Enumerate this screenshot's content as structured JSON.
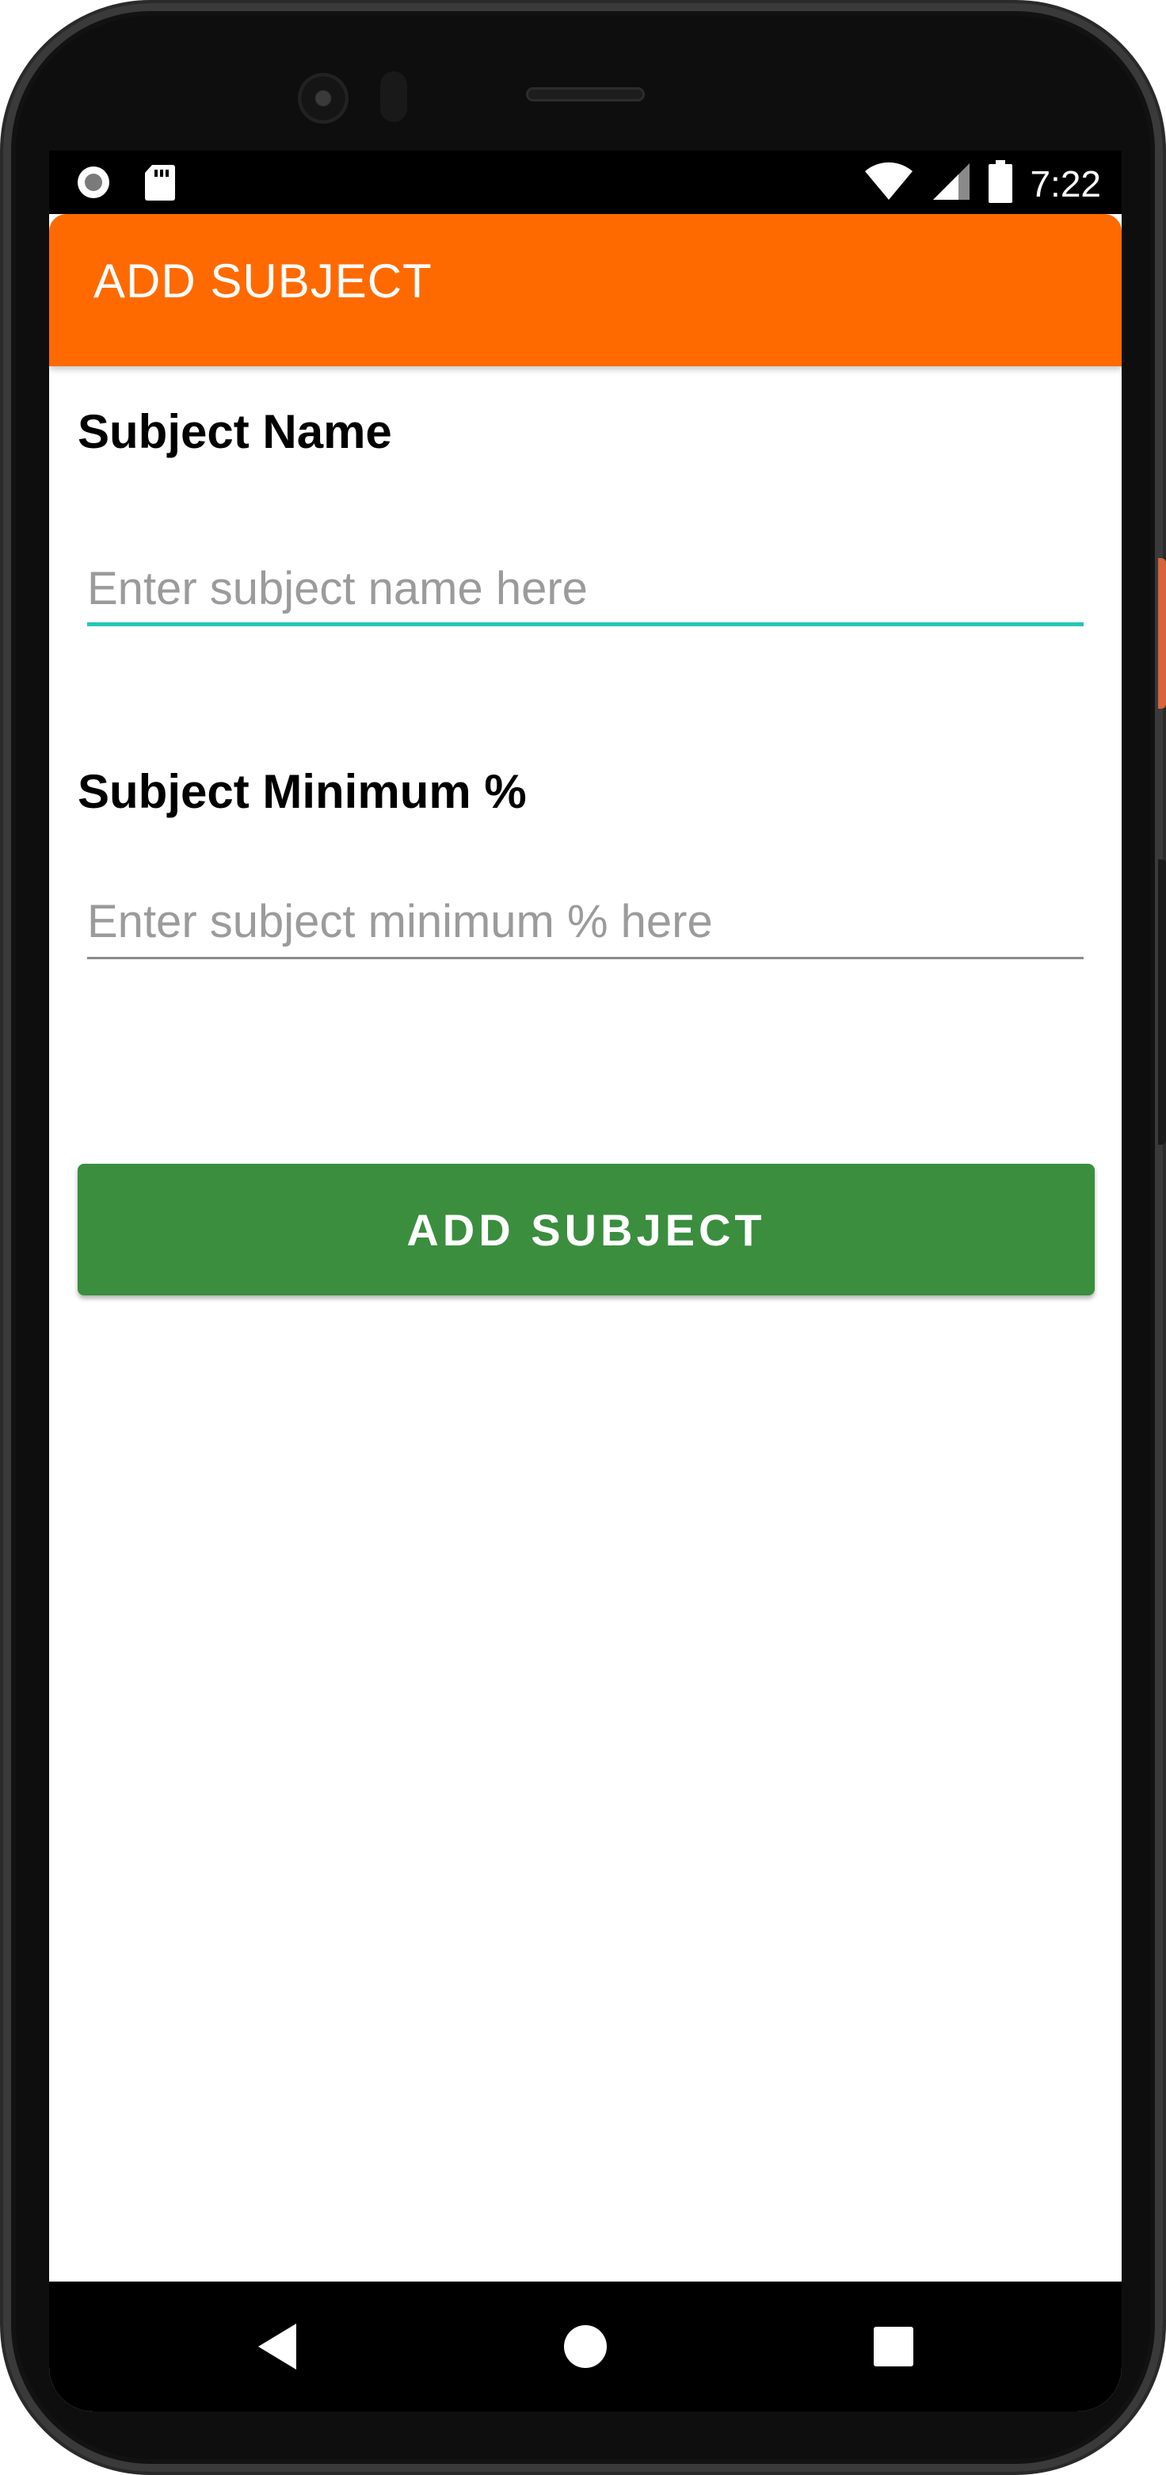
{
  "status_bar": {
    "time": "7:22",
    "icons": [
      "notification-circle-icon",
      "sd-card-icon",
      "wifi-icon",
      "signal-icon",
      "battery-icon"
    ]
  },
  "app_bar": {
    "title": "ADD SUBJECT",
    "color": "#ff6a00"
  },
  "form": {
    "subject_name": {
      "label": "Subject Name",
      "value": "",
      "placeholder": "Enter subject name here",
      "focused": true,
      "focus_color": "#26c6b8"
    },
    "subject_minimum": {
      "label": "Subject Minimum %",
      "value": "",
      "placeholder": "Enter subject minimum % here",
      "focused": false
    },
    "submit": {
      "label": "ADD SUBJECT",
      "color": "#3a8e3e"
    }
  },
  "nav_bar": {
    "buttons": [
      "back-icon",
      "home-icon",
      "recents-icon"
    ]
  }
}
